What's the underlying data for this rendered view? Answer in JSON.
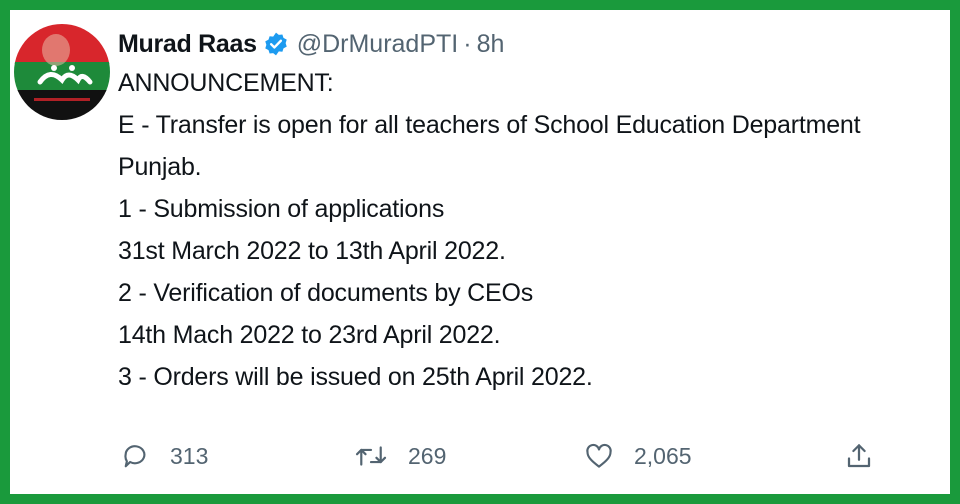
{
  "colors": {
    "frame": "#1a9a3c",
    "verified": "#1d9bf0",
    "muted": "#536471",
    "text": "#0f1419"
  },
  "author": {
    "name": "Murad Raas",
    "handle": "@DrMuradPTI",
    "separator": "·",
    "time": "8h",
    "avatar_icon": "profile-avatar",
    "verified_icon": "verified-badge-icon"
  },
  "body": {
    "lines": [
      "ANNOUNCEMENT:",
      "E - Transfer is open for all teachers of School Education Department",
      "Punjab.",
      "1 - Submission of applications",
      "31st March 2022 to 13th April 2022.",
      "2 - Verification of documents by CEOs",
      "14th Mach 2022 to 23rd April 2022.",
      "3 - Orders will be issued on 25th April 2022."
    ]
  },
  "actions": {
    "reply": {
      "icon": "reply-icon",
      "count": "313"
    },
    "retweet": {
      "icon": "retweet-icon",
      "count": "269"
    },
    "like": {
      "icon": "heart-icon",
      "count": "2,065"
    },
    "share": {
      "icon": "share-icon"
    }
  }
}
